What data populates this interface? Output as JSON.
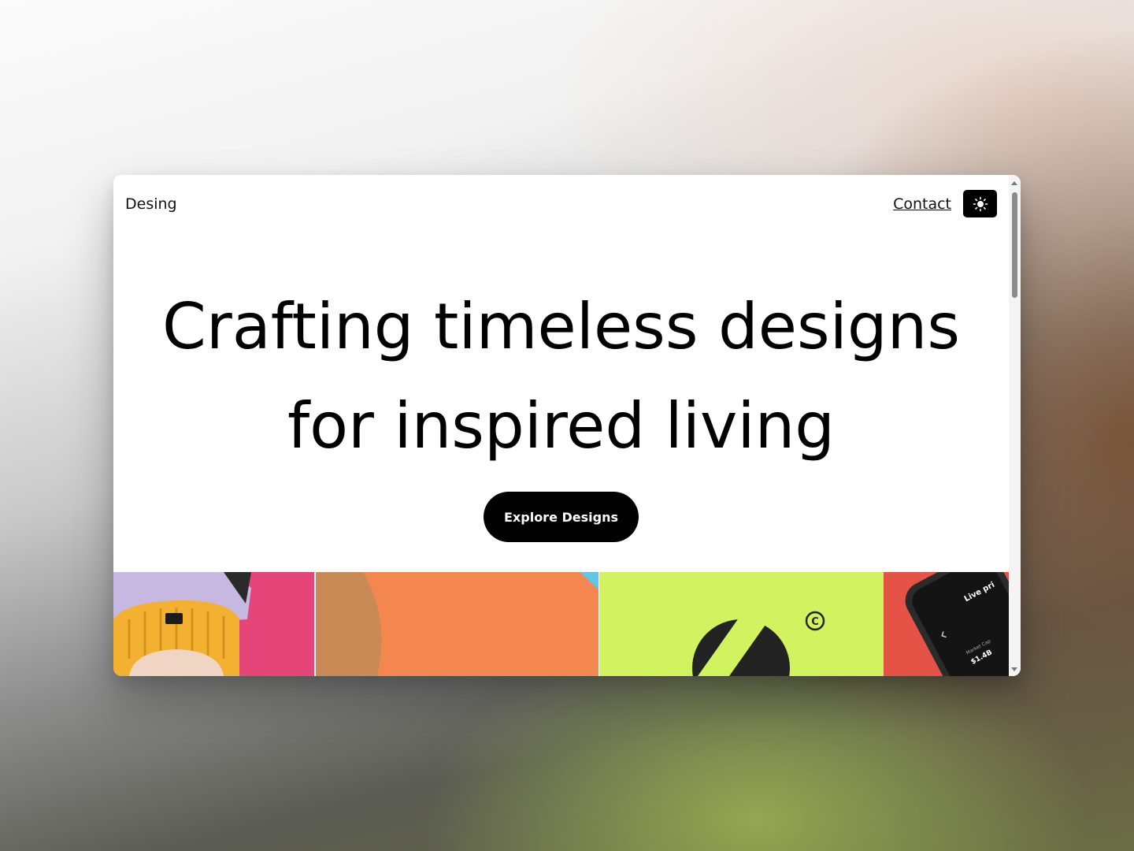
{
  "header": {
    "brand": "Desing",
    "contact_label": "Contact",
    "theme_toggle_icon": "sun-icon"
  },
  "hero": {
    "title_line_1": "Crafting timeless designs",
    "title_line_2": "for inspired living",
    "cta_label": "Explore Designs"
  },
  "gallery": {
    "tiles": [
      {
        "subject": "person-in-beanie-photo",
        "accent": "#e54579"
      },
      {
        "subject": "orange-abstract-shape",
        "accent": "#f07a3e"
      },
      {
        "subject": "logo-mark-on-lime",
        "accent": "#d3f260",
        "mark": "©"
      },
      {
        "subject": "phone-app-mockup",
        "accent": "#e55346",
        "screen_text": [
          "Live pri",
          "Market Cap",
          "$1.4B"
        ]
      }
    ]
  },
  "colors": {
    "button_bg": "#000000",
    "button_text": "#ffffff",
    "window_bg": "#ffffff"
  }
}
